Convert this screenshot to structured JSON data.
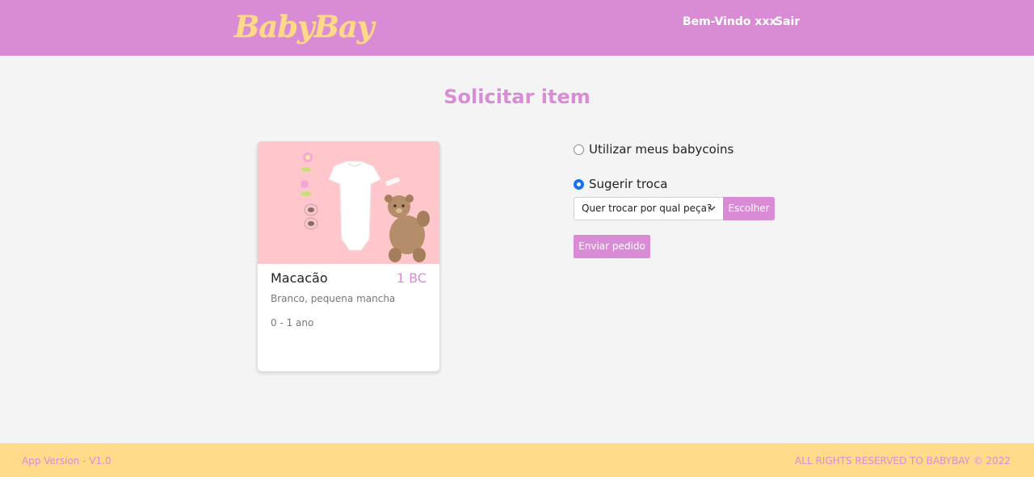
{
  "header": {
    "logo": "BabyBay",
    "welcome": "Bem-Vindo xxx",
    "logout": "Sair"
  },
  "page": {
    "title": "Solicitar item"
  },
  "item": {
    "name": "Macacão",
    "price": "1 BC",
    "description": "Branco, pequena mancha",
    "age": "0 - 1 ano"
  },
  "options": {
    "use_coins_label": "Utilizar meus babycoins",
    "use_coins_checked": false,
    "swap_label": "Sugerir troca",
    "swap_checked": true,
    "swap_select_value": "Quer trocar por qual peça?",
    "choose_button": "Escolher",
    "send_button": "Enviar pedido"
  },
  "footer": {
    "version": "App Version - V1.0",
    "rights": "ALL RIGHTS RESERVED TO BABYBAY © 2022"
  },
  "colors": {
    "brand_pink": "#da8bd5",
    "brand_yellow": "#ffdb8a",
    "radio_blue": "#1a73e8"
  }
}
